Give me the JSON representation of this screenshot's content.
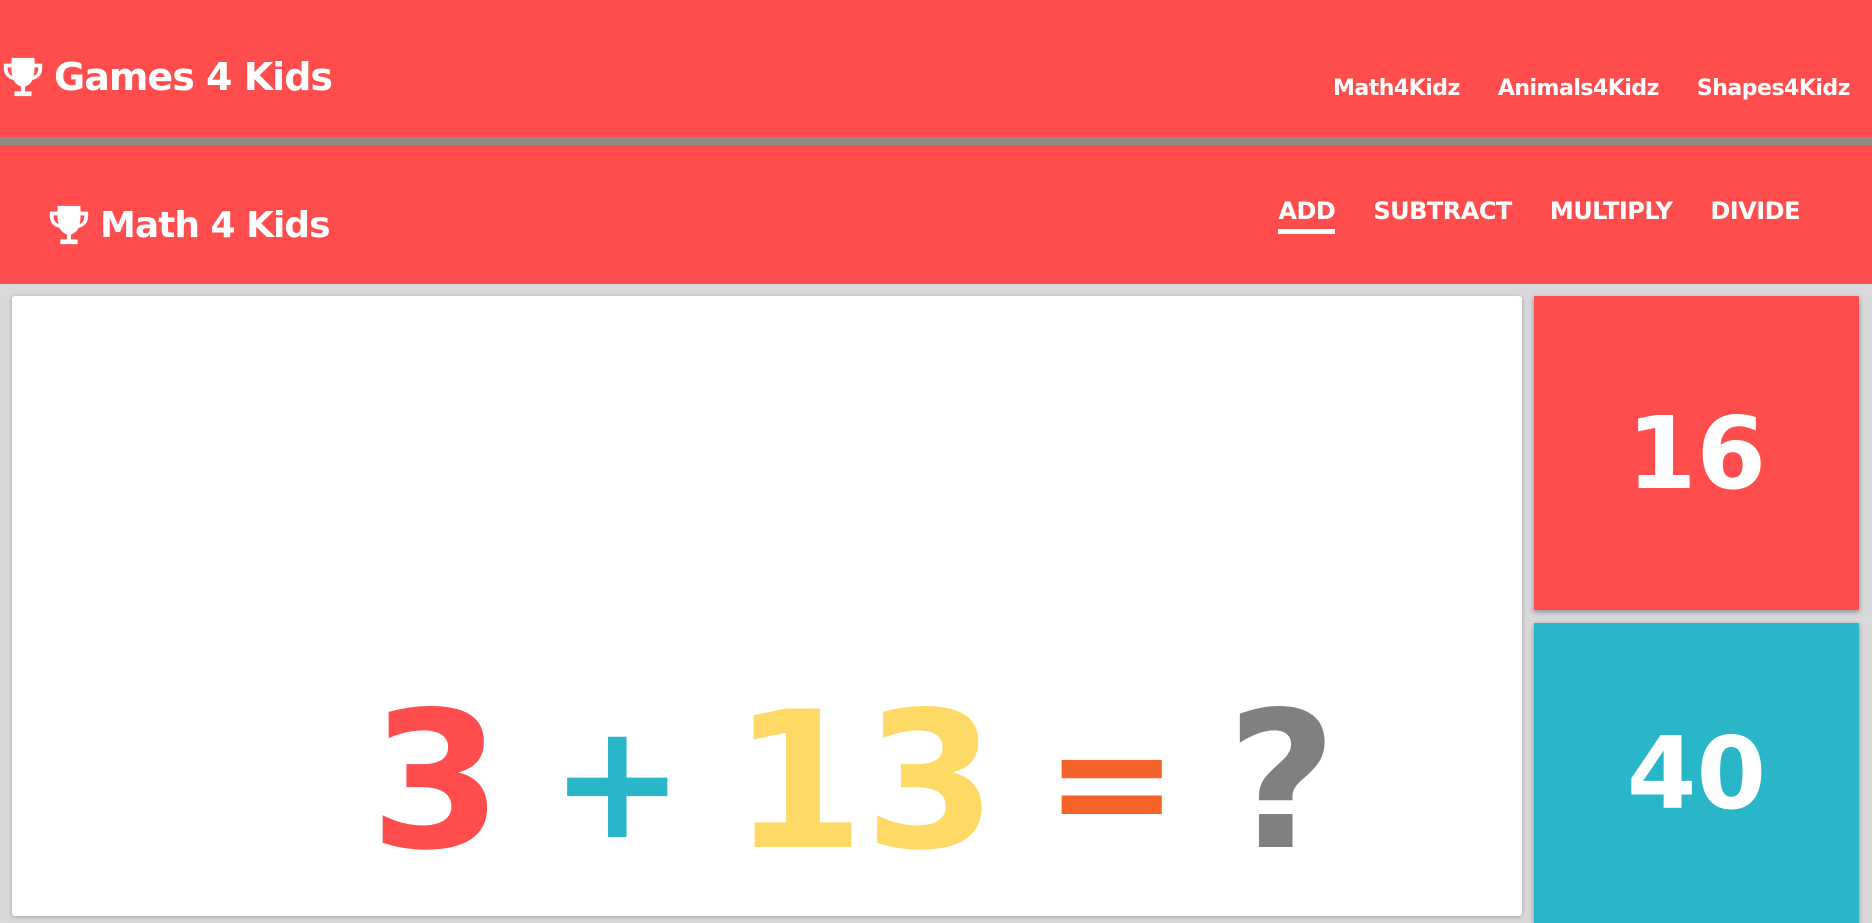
{
  "header": {
    "brand": "Games 4 Kids",
    "nav": [
      "Math4Kidz",
      "Animals4Kidz",
      "Shapes4Kidz"
    ]
  },
  "subheader": {
    "brand": "Math 4 Kids",
    "tabs": [
      {
        "label": "ADD",
        "active": true
      },
      {
        "label": "SUBTRACT",
        "active": false
      },
      {
        "label": "MULTIPLY",
        "active": false
      },
      {
        "label": "DIVIDE",
        "active": false
      }
    ]
  },
  "equation": {
    "operand1": "3",
    "operator": "+",
    "operand2": "13",
    "equals": "=",
    "unknown": "?"
  },
  "answers": [
    {
      "value": "16",
      "color": "#ff4c4c"
    },
    {
      "value": "40",
      "color": "#29b6c9"
    }
  ],
  "colors": {
    "brand": "#ff4c4c",
    "operand1": "#ff4c4c",
    "operator": "#29b6c9",
    "operand2": "#ffd966",
    "equals": "#f4632a",
    "unknown": "#808080"
  }
}
